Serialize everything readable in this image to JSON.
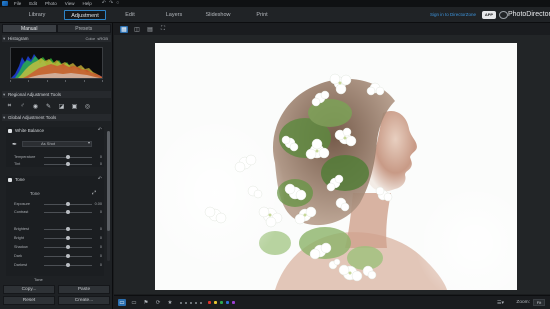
{
  "menubar": {
    "items": [
      "File",
      "Edit",
      "Photo",
      "View",
      "Help"
    ]
  },
  "modules": {
    "tabs": [
      "Library",
      "Adjustment",
      "Edit",
      "Layers",
      "Slideshow",
      "Print"
    ],
    "active": "Adjustment",
    "signin": "Sign in to DirectorZone",
    "app_badge": "APP",
    "brand": "PhotoDirector"
  },
  "panel": {
    "tabs": [
      "Manual",
      "Presets"
    ],
    "active_tab": "Manual",
    "histogram": {
      "title": "Histogram",
      "color_label": "Color",
      "color_value": "sRGB"
    },
    "regional": {
      "title": "Regional Adjustment Tools"
    },
    "global": {
      "title": "Global Adjustment Tools"
    },
    "white_balance": {
      "title": "White Balance",
      "preset": "As Shot",
      "sliders": [
        {
          "label": "Temperature",
          "value": "0",
          "level": 0.5
        },
        {
          "label": "Tint",
          "value": "0",
          "level": 0.5
        }
      ]
    },
    "tone": {
      "title": "Tone",
      "subtitle": "Tone",
      "sliders": [
        {
          "label": "Exposure",
          "value": "0.00",
          "level": 0.5
        },
        {
          "label": "Contrast",
          "value": "0",
          "level": 0.5
        },
        {
          "label": "Brightest",
          "value": "0",
          "level": 0.5
        },
        {
          "label": "Bright",
          "value": "0",
          "level": 0.5
        },
        {
          "label": "Shadow",
          "value": "0",
          "level": 0.5
        },
        {
          "label": "Dark",
          "value": "0",
          "level": 0.5
        },
        {
          "label": "Darkest",
          "value": "0",
          "level": 0.5
        }
      ],
      "footer": "Tone"
    },
    "buttons": {
      "copy": "Copy...",
      "paste": "Paste",
      "reset": "Reset",
      "create": "Create..."
    }
  },
  "statusbar": {
    "zoom_label": "Zoom:",
    "zoom_value": "Fit",
    "colors": [
      "#e0322b",
      "#e7c630",
      "#2fa84f",
      "#2f6fd6",
      "#9b3fd0"
    ]
  },
  "icons": {
    "regional_tools": [
      "crop-icon",
      "spot-removal-icon",
      "red-eye-icon",
      "brush-icon",
      "gradient-icon",
      "radial-filter-icon",
      "target-icon"
    ],
    "view_tools": [
      "grid-view-icon",
      "compare-icon",
      "filmstrip-icon",
      "fullscreen-icon"
    ]
  },
  "colors": {
    "accent": "#2e83c6",
    "link": "#3d95de"
  }
}
